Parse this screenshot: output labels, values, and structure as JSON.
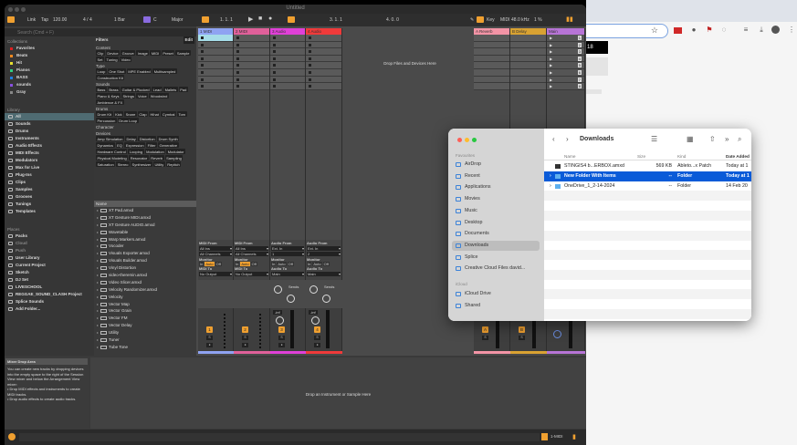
{
  "live": {
    "title": "Untitled",
    "toolbar": {
      "link": "Link",
      "tap": "Tap",
      "tempo": "120.00",
      "signature": "4 / 4",
      "quantize": "1 Bar",
      "key": "C",
      "scale": "Major",
      "position": "1.  1.  1",
      "loop_start": "3.  1.  1",
      "loop_length": "4.  0.  0",
      "key_label": "Key",
      "midi_label": "MIDI",
      "sample_rate": "48.0 kHz",
      "cpu": "1 %"
    },
    "search_placeholder": "Search (Cmd + F)",
    "sidebar": {
      "collections_label": "Collections",
      "collections": [
        {
          "label": "Favorites",
          "color": "#e02020"
        },
        {
          "label": "Beats",
          "color": "#f08a20"
        },
        {
          "label": "Hit",
          "color": "#e8e030"
        },
        {
          "label": "Pianos",
          "color": "#30d080"
        },
        {
          "label": "BASS",
          "color": "#2080e0"
        },
        {
          "label": "sounds",
          "color": "#8a50e0"
        },
        {
          "label": "Gray",
          "color": "#888888"
        }
      ],
      "library_label": "Library",
      "library": [
        "All",
        "Sounds",
        "Drums",
        "Instruments",
        "Audio Effects",
        "MIDI Effects",
        "Modulators",
        "Max for Live",
        "Plug-Ins",
        "Clips",
        "Samples",
        "Grooves",
        "Tunings",
        "Templates"
      ],
      "places_label": "Places",
      "places": [
        "Packs",
        "Cloud",
        "Push",
        "User Library",
        "Current Project",
        "Sketch",
        "DJ Set",
        "LIVESCHOOL",
        "REGGAE_SOUND_CLASH Project",
        "Splice Sounds",
        "Add Folder..."
      ]
    },
    "filters": {
      "title": "Filters",
      "edit": "Edit",
      "sections": [
        {
          "label": "Content",
          "tags": [
            "Clip",
            "Device",
            "Groove",
            "Image",
            "MIDI",
            "Preset",
            "Sample",
            "Set",
            "Tuning",
            "Video"
          ]
        },
        {
          "label": "Type",
          "tags": [
            "Loop",
            "One Shot",
            "MPE Enabled",
            "Multisampled",
            "Construction Kit"
          ]
        },
        {
          "label": "Sounds",
          "tags": [
            "Bass",
            "Brass",
            "Guitar & Plucked",
            "Lead",
            "Mallets",
            "Pad",
            "Piano & Keys",
            "Strings",
            "Voice",
            "Woodwind",
            "Ambience & FX"
          ]
        },
        {
          "label": "Drums",
          "tags": [
            "Drum Kit",
            "Kick",
            "Snare",
            "Clap",
            "Hihat",
            "Cymbal",
            "Tom",
            "Percussion",
            "Drum Loop"
          ]
        },
        {
          "label": "Character",
          "tags": []
        },
        {
          "label": "Devices",
          "tags": [
            "Amp Simulation",
            "Delay",
            "Distortion",
            "Drum Synth",
            "Dynamics",
            "EQ",
            "Expression",
            "Filter",
            "Generative",
            "Hardware Control",
            "Looping",
            "Modulation",
            "Modulator",
            "Physical Modeling",
            "Resonator",
            "Reverb",
            "Sampling",
            "Saturation",
            "Stereo",
            "Synthesizer",
            "Utility",
            "Repitch"
          ]
        }
      ]
    },
    "namelist": {
      "header": "Name",
      "items": [
        "XT Pad.amxd",
        "XT Gesture MIDI.amxd",
        "XT Gesture AUDIO.amxd",
        "Wavetable",
        "Warp Markers.amxd",
        "Vocoder",
        "Visuals Exporter.amxd",
        "Visuals Builder.amxd",
        "Vinyl Distortion",
        "video-theremin.amxd",
        "Video Slicer.amxd",
        "Velocity Randomizer.amxd",
        "Velocity",
        "Vector Map",
        "Vector Grain",
        "Vector FM",
        "Vector Delay",
        "Utility",
        "Tuner",
        "Tube Tone"
      ]
    },
    "tracks": [
      {
        "name": "1 MIDI",
        "color": "#8fa3f2",
        "number": "1",
        "io_from": "MIDI From",
        "from": "All Ins",
        "chan": "All Channels",
        "to_label": "MIDI To",
        "to": "No Output"
      },
      {
        "name": "2 MIDI",
        "color": "#e0609a",
        "number": "2",
        "io_from": "MIDI From",
        "from": "All Ins",
        "chan": "All Channels",
        "to_label": "MIDI To",
        "to": "No Output"
      },
      {
        "name": "3 Audio",
        "color": "#e040d8",
        "number": "3",
        "io_from": "Audio From",
        "from": "Ext. In",
        "chan": "1",
        "to_label": "Audio To",
        "to": "Main"
      },
      {
        "name": "4 Audio",
        "color": "#f03a3a",
        "number": "4",
        "io_from": "Audio From",
        "from": "Ext. In",
        "chan": "2",
        "to_label": "Audio To",
        "to": "Main"
      }
    ],
    "returns": [
      {
        "name": "A Reverb",
        "color": "#f394a6",
        "number": "A"
      },
      {
        "name": "B Delay",
        "color": "#d9a232",
        "number": "B"
      },
      {
        "name": "Main",
        "color": "#b774d6"
      }
    ],
    "monitor": {
      "in": "In",
      "auto": "Auto",
      "off": "Off",
      "label": "Monitor"
    },
    "sends_label": "Sends",
    "volume": "-inf",
    "scene_numbers": [
      "1",
      "2",
      "3",
      "4",
      "5",
      "6",
      "7",
      "8"
    ],
    "drop_files": "Drop Files and Devices Here",
    "drop_instrument": "Drop an Instrument or Sample Here",
    "info": {
      "title": "Mixer Drop Area",
      "body": "You can create new tracks by dropping devices into the empty space to the right of the Session View mixer and below the Arrangement View mixer:",
      "bullets": [
        "Drop MIDI effects and instruments to create MIDI tracks.",
        "Drop audio effects to create audio tracks."
      ]
    },
    "status": {
      "track": "1-MIDI"
    }
  },
  "finder": {
    "title": "Downloads",
    "favourites_label": "Favourites",
    "favourites": [
      "AirDrop",
      "Recent",
      "Applications",
      "Movies",
      "Music",
      "Desktop",
      "Documents",
      "Downloads",
      "Splice",
      "Creative Cloud Files  david..."
    ],
    "icloud_label": "iCloud",
    "icloud": [
      "iCloud Drive",
      "Shared"
    ],
    "columns": [
      "Name",
      "Size",
      "Kind",
      "Date Added"
    ],
    "rows": [
      {
        "name": "STINGIS4 b...ERBOX.amxd",
        "size": "569 KB",
        "kind": "Ableto...x Patch",
        "date": "Today at 1"
      },
      {
        "name": "New Folder With Items",
        "size": "--",
        "kind": "Folder",
        "date": "Today at 1",
        "selected": true
      },
      {
        "name": "OneDrive_1_2-14-2024",
        "size": "--",
        "kind": "Folder",
        "date": "14 Feb 20"
      }
    ]
  },
  "chrome": {
    "page_box_text": "18"
  }
}
